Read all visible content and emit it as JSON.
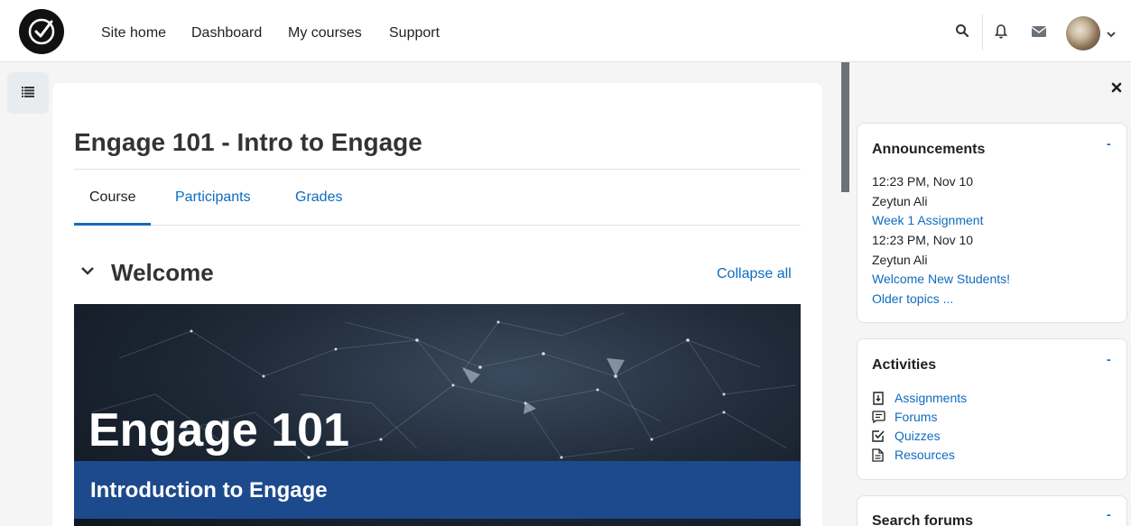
{
  "navbar": {
    "logo_icon": "checkmark-circle-logo",
    "links": [
      "Site home",
      "Dashboard",
      "My courses",
      "Support"
    ],
    "icons": [
      "search-icon",
      "bell-icon",
      "envelope-icon",
      "chevron-down-icon"
    ]
  },
  "course": {
    "title": "Engage 101 - Intro to Engage",
    "tabs": [
      "Course",
      "Participants",
      "Grades"
    ],
    "active_tab": "Course"
  },
  "section": {
    "title": "Welcome",
    "collapse_all": "Collapse all"
  },
  "banner": {
    "heading": "Engage 101",
    "subheading": "Introduction to Engage"
  },
  "blocks": {
    "announcements": {
      "title": "Announcements",
      "minimize": "-",
      "items": [
        {
          "time": "12:23 PM, Nov 10",
          "author": "Zeytun Ali",
          "topic": "Week 1 Assignment"
        },
        {
          "time": "12:23 PM, Nov 10",
          "author": "Zeytun Ali",
          "topic": "Welcome New Students!"
        }
      ],
      "older": "Older topics ..."
    },
    "activities": {
      "title": "Activities",
      "minimize": "-",
      "items": [
        {
          "label": "Assignments",
          "icon": "assignment-icon"
        },
        {
          "label": "Forums",
          "icon": "forum-icon"
        },
        {
          "label": "Quizzes",
          "icon": "quiz-icon"
        },
        {
          "label": "Resources",
          "icon": "resource-icon"
        }
      ]
    },
    "search_forums": {
      "title": "Search forums",
      "minimize": "-"
    }
  },
  "colors": {
    "link": "#0f6cbf",
    "banner_strip": "#1c4a8c",
    "text": "#1d2125"
  }
}
